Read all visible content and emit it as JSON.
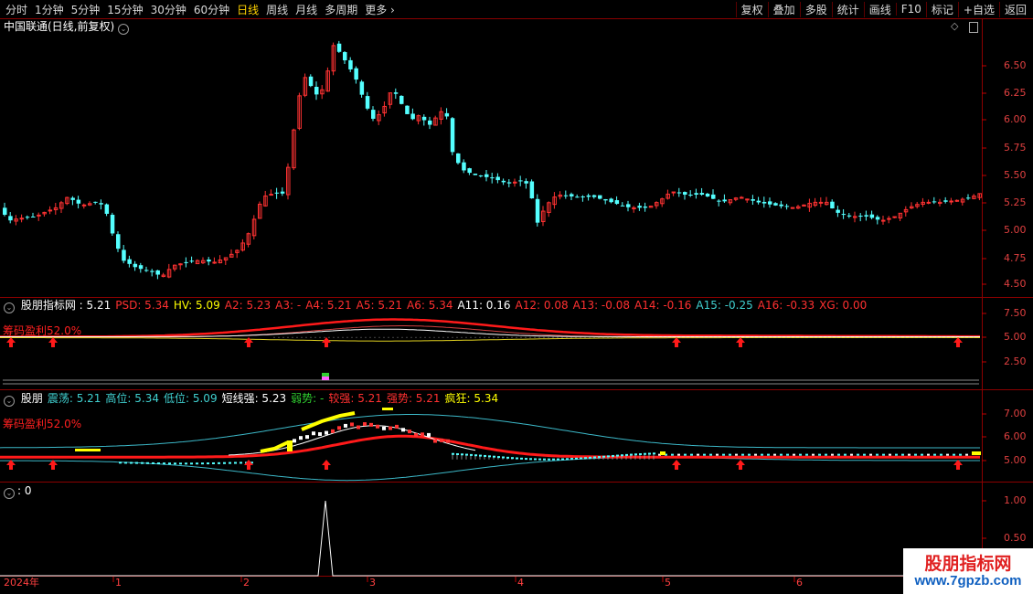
{
  "toolbar": {
    "periods": [
      "分时",
      "1分钟",
      "5分钟",
      "15分钟",
      "30分钟",
      "60分钟",
      "日线",
      "周线",
      "月线",
      "多周期",
      "更多"
    ],
    "active_period": "日线",
    "right_buttons": [
      "复权",
      "叠加",
      "多股",
      "统计",
      "画线",
      "F10",
      "标记",
      "+自选",
      "返回"
    ]
  },
  "main_chart": {
    "title": "中国联通(日线,前复权)",
    "y_ticks": [
      "6.50",
      "6.25",
      "6.00",
      "5.75",
      "5.50",
      "5.25",
      "5.00",
      "4.75",
      "4.50"
    ]
  },
  "panel1": {
    "items": [
      {
        "label": "股朋指标网",
        "value": ": 5.21",
        "color": "#ffffff"
      },
      {
        "label": "PSD:",
        "value": "5.34",
        "color": "#ff3030"
      },
      {
        "label": "HV:",
        "value": "5.09",
        "color": "#ffff00"
      },
      {
        "label": "A2:",
        "value": "5.23",
        "color": "#ff3030"
      },
      {
        "label": "A3:",
        "value": "-",
        "color": "#ff3030"
      },
      {
        "label": "A4:",
        "value": "5.21",
        "color": "#ff3030"
      },
      {
        "label": "A5:",
        "value": "5.21",
        "color": "#ff3030"
      },
      {
        "label": "A6:",
        "value": "5.34",
        "color": "#ff3030"
      },
      {
        "label": "A11:",
        "value": "0.16",
        "color": "#ffffff"
      },
      {
        "label": "A12:",
        "value": "0.08",
        "color": "#ff3030"
      },
      {
        "label": "A13:",
        "value": "-0.08",
        "color": "#ff3030"
      },
      {
        "label": "A14:",
        "value": "-0.16",
        "color": "#ff3030"
      },
      {
        "label": "A15:",
        "value": "-0.25",
        "color": "#40d0d0"
      },
      {
        "label": "A16:",
        "value": "-0.33",
        "color": "#ff3030"
      },
      {
        "label": "XG:",
        "value": "0.00",
        "color": "#ff3030"
      }
    ],
    "profit_label": "筹码盈利52.0%",
    "y_ticks": [
      "7.50",
      "5.00",
      "2.50"
    ]
  },
  "panel2": {
    "items": [
      {
        "label": "股朋",
        "value": "",
        "color": "#ffffff"
      },
      {
        "label": "震荡:",
        "value": "5.21",
        "color": "#40d0d0"
      },
      {
        "label": "高位:",
        "value": "5.34",
        "color": "#40d0d0"
      },
      {
        "label": "低位:",
        "value": "5.09",
        "color": "#40d0d0"
      },
      {
        "label": "短线强:",
        "value": "5.23",
        "color": "#ffffff"
      },
      {
        "label": "弱势:",
        "value": "-",
        "color": "#30d030"
      },
      {
        "label": "较强:",
        "value": "5.21",
        "color": "#ff3030"
      },
      {
        "label": "强势:",
        "value": "5.21",
        "color": "#ff3030"
      },
      {
        "label": "疯狂:",
        "value": "5.34",
        "color": "#ffff00"
      }
    ],
    "profit_label": "筹码盈利52.0%",
    "y_ticks": [
      "7.00",
      "6.00",
      "5.00"
    ]
  },
  "panel3": {
    "label": ": 0",
    "y_ticks": [
      "1.00",
      "0.50"
    ]
  },
  "x_axis": [
    "2024年",
    "1",
    "2",
    "3",
    "4",
    "5",
    "6"
  ],
  "watermark": {
    "line1": "股朋指标网",
    "line2": "www.7gpzb.com"
  },
  "colors": {
    "up": "#ff3232",
    "down": "#54ffff",
    "panel_border": "#8b0000"
  }
}
